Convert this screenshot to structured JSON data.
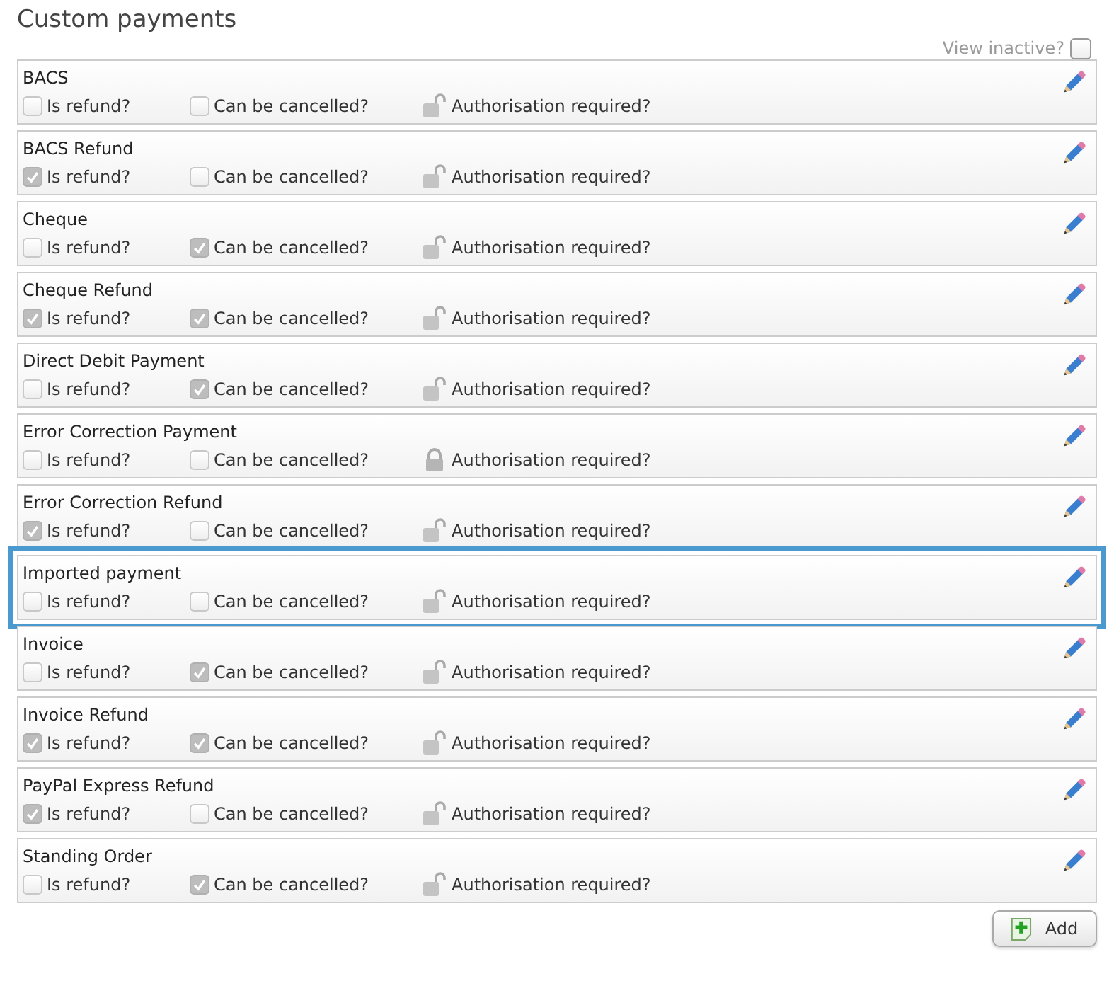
{
  "title": "Custom payments",
  "view_inactive": {
    "label": "View inactive?",
    "checked": false
  },
  "payments": [
    {
      "name": "BACS",
      "refund_label": "Is refund?",
      "refund_checked": false,
      "cancel_label": "Can be cancelled?",
      "cancel_checked": false,
      "auth_label": "Authorisation required?",
      "auth_locked": false,
      "selected": false
    },
    {
      "name": "BACS Refund",
      "refund_label": "Is refund?",
      "refund_checked": true,
      "cancel_label": "Can be cancelled?",
      "cancel_checked": false,
      "auth_label": "Authorisation required?",
      "auth_locked": false,
      "selected": false
    },
    {
      "name": "Cheque",
      "refund_label": "Is refund?",
      "refund_checked": false,
      "cancel_label": "Can be cancelled?",
      "cancel_checked": true,
      "auth_label": "Authorisation required?",
      "auth_locked": false,
      "selected": false
    },
    {
      "name": "Cheque Refund",
      "refund_label": "Is refund?",
      "refund_checked": true,
      "cancel_label": "Can be cancelled?",
      "cancel_checked": true,
      "auth_label": "Authorisation required?",
      "auth_locked": false,
      "selected": false
    },
    {
      "name": "Direct Debit Payment",
      "refund_label": "Is refund?",
      "refund_checked": false,
      "cancel_label": "Can be cancelled?",
      "cancel_checked": true,
      "auth_label": "Authorisation required?",
      "auth_locked": false,
      "selected": false
    },
    {
      "name": "Error Correction Payment",
      "refund_label": "Is refund?",
      "refund_checked": false,
      "cancel_label": "Can be cancelled?",
      "cancel_checked": false,
      "auth_label": "Authorisation required?",
      "auth_locked": true,
      "selected": false
    },
    {
      "name": "Error Correction Refund",
      "refund_label": "Is refund?",
      "refund_checked": true,
      "cancel_label": "Can be cancelled?",
      "cancel_checked": false,
      "auth_label": "Authorisation required?",
      "auth_locked": false,
      "selected": false
    },
    {
      "name": "Imported payment",
      "refund_label": "Is refund?",
      "refund_checked": false,
      "cancel_label": "Can be cancelled?",
      "cancel_checked": false,
      "auth_label": "Authorisation required?",
      "auth_locked": false,
      "selected": true
    },
    {
      "name": "Invoice",
      "refund_label": "Is refund?",
      "refund_checked": false,
      "cancel_label": "Can be cancelled?",
      "cancel_checked": true,
      "auth_label": "Authorisation required?",
      "auth_locked": false,
      "selected": false
    },
    {
      "name": "Invoice Refund",
      "refund_label": "Is refund?",
      "refund_checked": true,
      "cancel_label": "Can be cancelled?",
      "cancel_checked": true,
      "auth_label": "Authorisation required?",
      "auth_locked": false,
      "selected": false
    },
    {
      "name": "PayPal Express Refund",
      "refund_label": "Is refund?",
      "refund_checked": true,
      "cancel_label": "Can be cancelled?",
      "cancel_checked": false,
      "auth_label": "Authorisation required?",
      "auth_locked": false,
      "selected": false
    },
    {
      "name": "Standing Order",
      "refund_label": "Is refund?",
      "refund_checked": false,
      "cancel_label": "Can be cancelled?",
      "cancel_checked": true,
      "auth_label": "Authorisation required?",
      "auth_locked": false,
      "selected": false
    }
  ],
  "add_button": "Add"
}
